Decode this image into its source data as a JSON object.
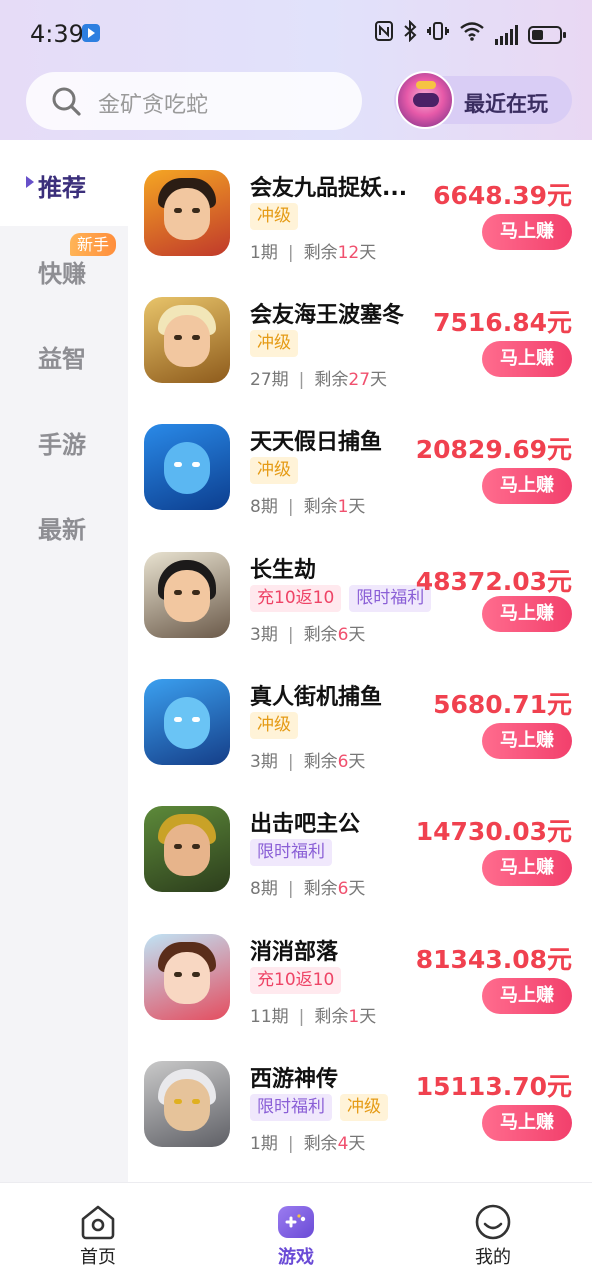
{
  "status_bar": {
    "time": "4:39",
    "icons": [
      "nfc-icon",
      "bluetooth-icon",
      "vibrate-icon",
      "wifi-icon",
      "signal-icon",
      "battery-icon"
    ]
  },
  "search": {
    "placeholder": "金矿贪吃蛇"
  },
  "recent": {
    "label": "最近在玩"
  },
  "sidebar": {
    "items": [
      {
        "label": "推荐",
        "active": true
      },
      {
        "label": "快赚",
        "badge": "新手"
      },
      {
        "label": "益智"
      },
      {
        "label": "手游"
      },
      {
        "label": "最新"
      }
    ]
  },
  "games": [
    {
      "title": "会友九品捉妖...",
      "tags": [
        {
          "type": "level",
          "text": "冲级"
        }
      ],
      "period": "1期",
      "remaining_prefix": "剩余",
      "remaining_num": "12",
      "remaining_suffix": "天",
      "amount": "6648.39元",
      "button": "马上赚"
    },
    {
      "title": "会友海王波塞冬",
      "tags": [
        {
          "type": "level",
          "text": "冲级"
        }
      ],
      "period": "27期",
      "remaining_prefix": "剩余",
      "remaining_num": "27",
      "remaining_suffix": "天",
      "amount": "7516.84元",
      "button": "马上赚"
    },
    {
      "title": "天天假日捕鱼",
      "tags": [
        {
          "type": "level",
          "text": "冲级"
        }
      ],
      "period": "8期",
      "remaining_prefix": "剩余",
      "remaining_num": "1",
      "remaining_suffix": "天",
      "amount": "20829.69元",
      "button": "马上赚"
    },
    {
      "title": "长生劫",
      "tags": [
        {
          "type": "recharge",
          "text": "充10返10"
        },
        {
          "type": "benefit",
          "text": "限时福利"
        }
      ],
      "period": "3期",
      "remaining_prefix": "剩余",
      "remaining_num": "6",
      "remaining_suffix": "天",
      "amount": "48372.03元",
      "button": "马上赚"
    },
    {
      "title": "真人街机捕鱼",
      "tags": [
        {
          "type": "level",
          "text": "冲级"
        }
      ],
      "period": "3期",
      "remaining_prefix": "剩余",
      "remaining_num": "6",
      "remaining_suffix": "天",
      "amount": "5680.71元",
      "button": "马上赚"
    },
    {
      "title": "出击吧主公",
      "tags": [
        {
          "type": "benefit",
          "text": "限时福利"
        }
      ],
      "period": "8期",
      "remaining_prefix": "剩余",
      "remaining_num": "6",
      "remaining_suffix": "天",
      "amount": "14730.03元",
      "button": "马上赚"
    },
    {
      "title": "消消部落",
      "tags": [
        {
          "type": "recharge",
          "text": "充10返10"
        }
      ],
      "period": "11期",
      "remaining_prefix": "剩余",
      "remaining_num": "1",
      "remaining_suffix": "天",
      "amount": "81343.08元",
      "button": "马上赚"
    },
    {
      "title": "西游神传",
      "tags": [
        {
          "type": "benefit",
          "text": "限时福利"
        },
        {
          "type": "level",
          "text": "冲级"
        }
      ],
      "period": "1期",
      "remaining_prefix": "剩余",
      "remaining_num": "4",
      "remaining_suffix": "天",
      "amount": "15113.70元",
      "button": "马上赚"
    }
  ],
  "bottom_nav": {
    "items": [
      {
        "label": "首页",
        "icon": "home-icon"
      },
      {
        "label": "游戏",
        "icon": "gamepad-icon",
        "active": true
      },
      {
        "label": "我的",
        "icon": "smile-icon"
      }
    ]
  },
  "colors": {
    "accent": "#6a4bd6",
    "amount": "#f0414f",
    "button": "#f2406c"
  }
}
